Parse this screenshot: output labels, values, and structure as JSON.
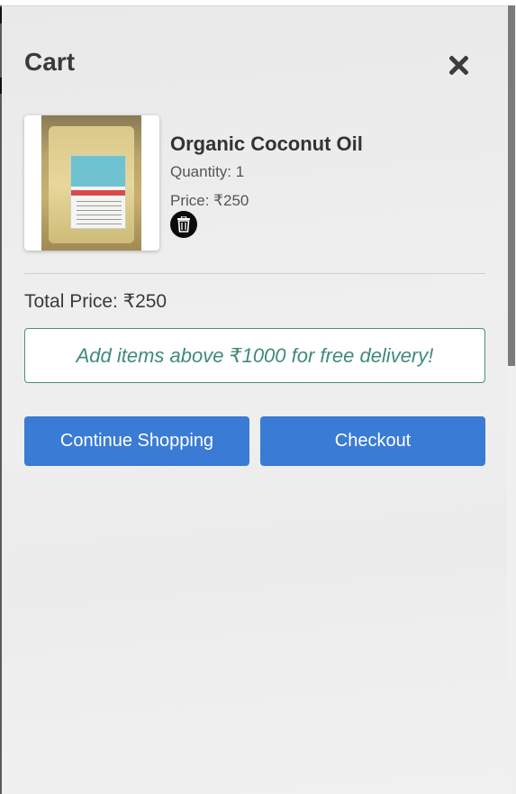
{
  "cart": {
    "title": "Cart",
    "items": [
      {
        "name": "Organic Coconut Oil",
        "quantity_text": "Quantity: 1",
        "price_text": "Price: ₹250",
        "image_icon": "coconut-oil-pack-photo"
      }
    ],
    "total_text": "Total Price: ₹250",
    "delivery_note": "Add items above ₹1000 for free delivery!",
    "buttons": {
      "continue_label": "Continue Shopping",
      "checkout_label": "Checkout"
    }
  },
  "colors": {
    "primary_button": "#3a7bd5",
    "note_border": "#4a8f80",
    "note_text": "#3f8a7a",
    "delete_bg": "#0b0b0b"
  },
  "icons": {
    "close": "close-icon",
    "delete": "trash-icon"
  }
}
